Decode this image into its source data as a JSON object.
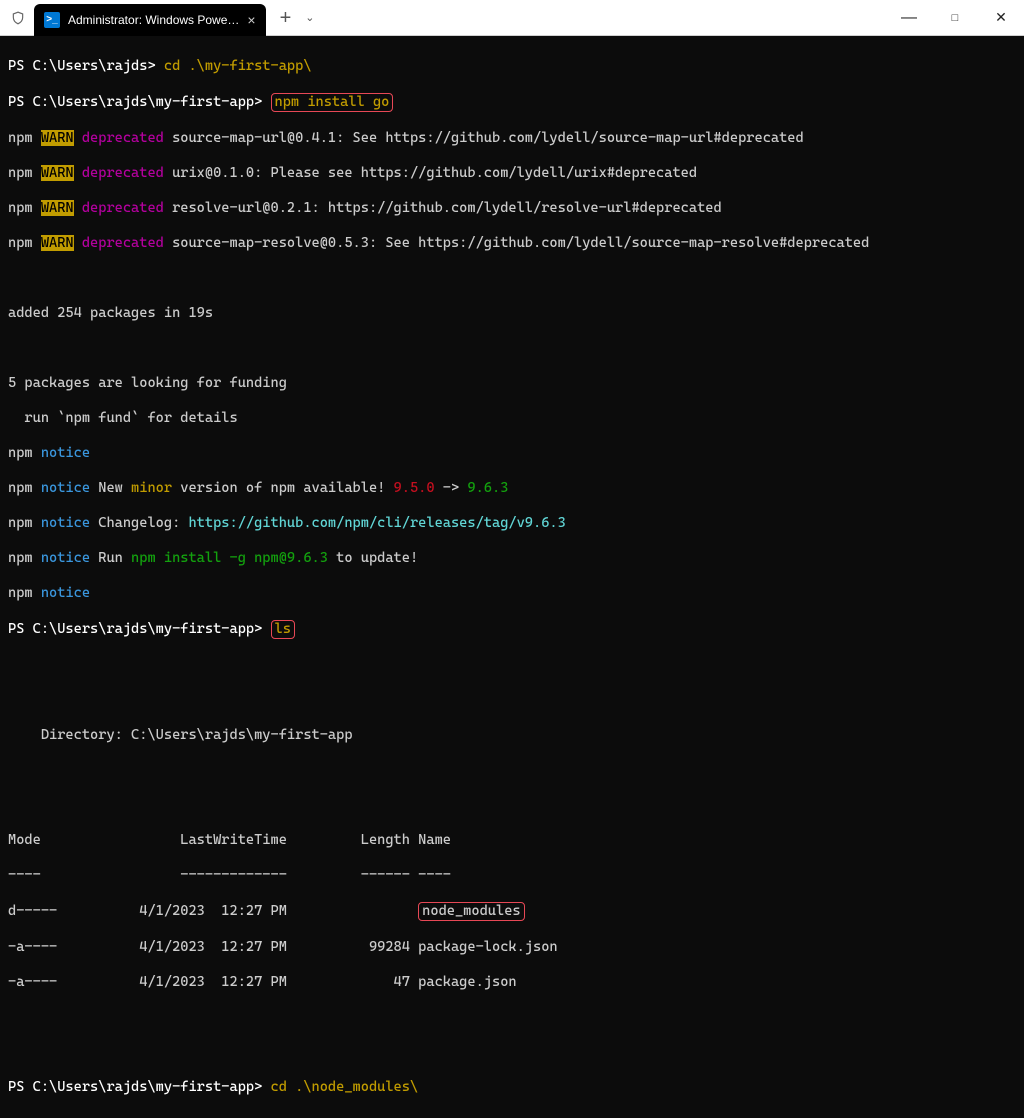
{
  "titlebar": {
    "tab_title": "Administrator: Windows Powe…",
    "ps_badge": ">_"
  },
  "t": {
    "p1_prompt": "PS C:\\Users\\rajds> ",
    "p1_cmd": "cd .\\my-first-app\\",
    "p2_prompt": "PS C:\\Users\\rajds\\my-first-app> ",
    "p2_cmd": "npm install go",
    "npm": "npm ",
    "warn": "WARN",
    "sp": " ",
    "deprecated": "deprecated",
    "w1_rest": " source-map-url@0.4.1: See https://github.com/lydell/source-map-url#deprecated",
    "w2_rest": " urix@0.1.0: Please see https://github.com/lydell/urix#deprecated",
    "w3_rest": " resolve-url@0.2.1: https://github.com/lydell/resolve-url#deprecated",
    "w4_rest": " source-map-resolve@0.5.3: See https://github.com/lydell/source-map-resolve#deprecated",
    "added": "added 254 packages in 19s",
    "funding1": "5 packages are looking for funding",
    "funding2": "  run `npm fund` for details",
    "notice": "notice",
    "notice_new1": " New ",
    "notice_minor": "minor",
    "notice_new2": " version of npm available! ",
    "v_old": "9.5.0",
    "arrow": " -> ",
    "v_new": "9.6.3",
    "changelog_lbl": " Changelog: ",
    "changelog_url": "https://github.com/npm/cli/releases/tag/v9.6.3",
    "run_lbl": " Run ",
    "run_cmd": "npm install -g npm@9.6.3",
    "run_tail": " to update!",
    "p3_prompt": "PS C:\\Users\\rajds\\my-first-app> ",
    "p3_cmd": "ls",
    "dir_line": "    Directory: C:\\Users\\rajds\\my-first-app",
    "hdr": "Mode                 LastWriteTime         Length Name",
    "hdr2": "----                 -------------         ------ ----",
    "r1a": "d-----          4/1/2023  12:27 PM                ",
    "r1b": "node_modules",
    "r2": "-a----          4/1/2023  12:27 PM          99284 package-lock.json",
    "r3": "-a----          4/1/2023  12:27 PM             47 package.json",
    "p4_prompt": "PS C:\\Users\\rajds\\my-first-app> ",
    "p4_cmd": "cd .\\node_modules\\"
  }
}
